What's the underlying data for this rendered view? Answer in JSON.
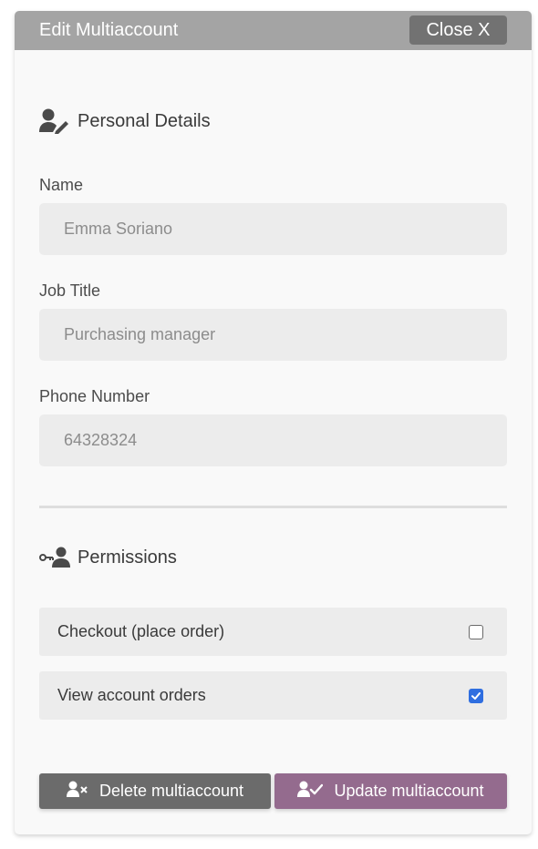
{
  "header": {
    "title": "Edit Multiaccount",
    "close_label": "Close X"
  },
  "personal": {
    "heading": "Personal Details",
    "icon": "user-edit-icon",
    "fields": [
      {
        "label": "Name",
        "value": "Emma Soriano"
      },
      {
        "label": "Job Title",
        "value": "Purchasing manager"
      },
      {
        "label": "Phone Number",
        "value": "64328324"
      }
    ]
  },
  "permissions": {
    "heading": "Permissions",
    "icon": "user-key-icon",
    "items": [
      {
        "label": "Checkout (place order)",
        "checked": false
      },
      {
        "label": "View account orders",
        "checked": true
      }
    ]
  },
  "actions": {
    "delete_label": "Delete multiaccount",
    "delete_icon": "user-remove-icon",
    "update_label": "Update multiaccount",
    "update_icon": "user-check-icon"
  },
  "colors": {
    "titlebar": "#a4a4a4",
    "close_button": "#727272",
    "delete_button": "#6b6b6b",
    "update_button": "#946b8e",
    "checkbox_checked": "#2f6ee0"
  }
}
